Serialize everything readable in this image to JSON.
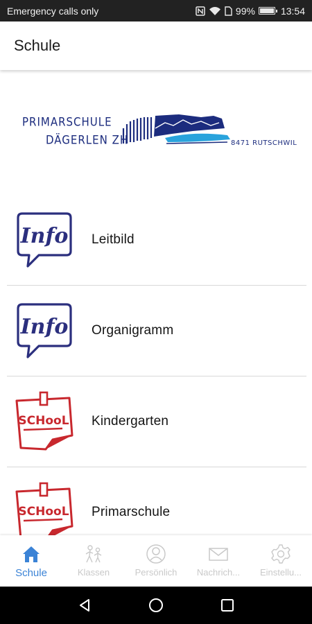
{
  "status_bar": {
    "carrier_text": "Emergency calls only",
    "battery": "99%",
    "time": "13:54",
    "icons": [
      "nfc-icon",
      "wifi-icon",
      "sim-icon",
      "battery-icon"
    ]
  },
  "app_bar": {
    "title": "Schule"
  },
  "logo": {
    "line1": "PRIMARSCHULE",
    "line2": "DÄGERLEN ZH",
    "line3": "8471 RUTSCHWIL",
    "colors": {
      "text": "#1c2c7e",
      "water": "#29a3dc"
    }
  },
  "list": {
    "items": [
      {
        "label": "Leitbild",
        "icon": "info-bubble-icon"
      },
      {
        "label": "Organigramm",
        "icon": "info-bubble-icon"
      },
      {
        "label": "Kindergarten",
        "icon": "school-note-icon"
      },
      {
        "label": "Primarschule",
        "icon": "school-note-icon"
      }
    ],
    "icon_text": {
      "info": "Info",
      "school": "SCHooL"
    }
  },
  "tabs": [
    {
      "label": "Schule",
      "icon": "home-icon",
      "active": true
    },
    {
      "label": "Klassen",
      "icon": "children-icon",
      "active": false
    },
    {
      "label": "Persönlich",
      "icon": "person-icon",
      "active": false
    },
    {
      "label": "Nachrich...",
      "icon": "envelope-icon",
      "active": false
    },
    {
      "label": "Einstellu...",
      "icon": "gear-icon",
      "active": false
    }
  ],
  "colors": {
    "accent": "#3b83d6",
    "inactive": "#c9c9c9",
    "info_blue": "#2b2f7e",
    "school_red": "#c8282e"
  }
}
